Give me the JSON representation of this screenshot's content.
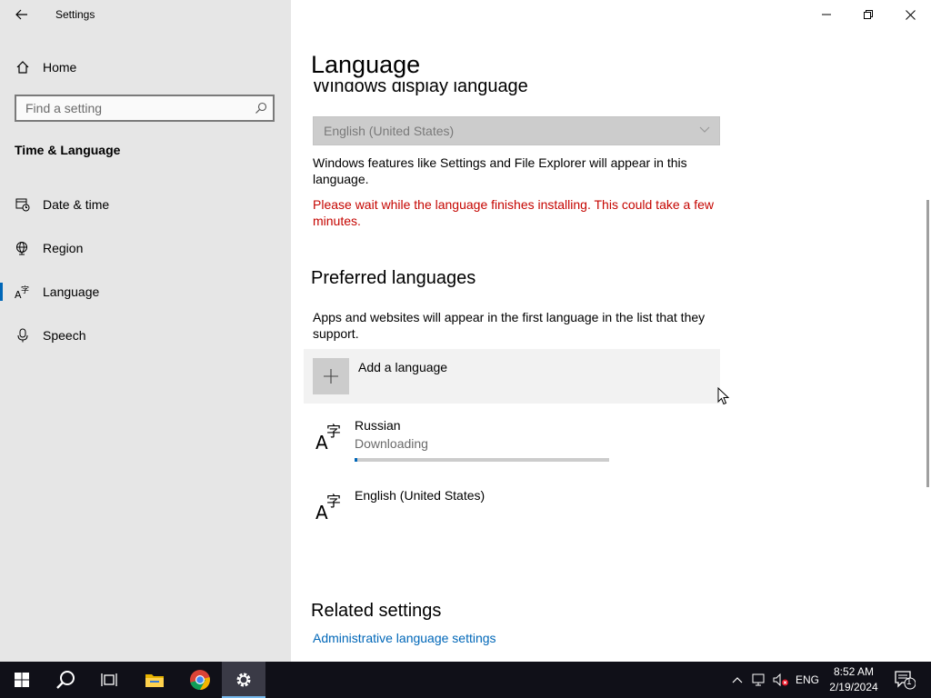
{
  "window": {
    "app_title": "Settings",
    "controls": [
      "minimize",
      "restore",
      "close"
    ]
  },
  "sidebar": {
    "home_label": "Home",
    "search_placeholder": "Find a setting",
    "section_heading": "Time & Language",
    "items": [
      {
        "label": "Date & time",
        "icon": "clock-calendar-icon",
        "selected": false
      },
      {
        "label": "Region",
        "icon": "globe-icon",
        "selected": false
      },
      {
        "label": "Language",
        "icon": "language-icon",
        "selected": true
      },
      {
        "label": "Speech",
        "icon": "microphone-icon",
        "selected": false
      }
    ]
  },
  "main": {
    "page_title": "Language",
    "display_language": {
      "heading": "Windows display language",
      "dropdown_value": "English (United States)",
      "description": "Windows features like Settings and File Explorer will appear in this language.",
      "warning": "Please wait while the language finishes installing. This could take a few minutes."
    },
    "preferred": {
      "heading": "Preferred languages",
      "description": "Apps and websites will appear in the first language in the list that they support.",
      "add_label": "Add a language",
      "languages": [
        {
          "name": "Russian",
          "status": "Downloading",
          "progress": 0.01
        },
        {
          "name": "English (United States)",
          "status": ""
        }
      ]
    },
    "related": {
      "heading": "Related settings",
      "link": "Administrative language settings"
    }
  },
  "taskbar": {
    "pinned": [
      "start-icon",
      "search-icon",
      "task-view-icon",
      "file-explorer-icon",
      "chrome-icon",
      "settings-icon"
    ],
    "active": "settings-icon",
    "language_indicator": "ENG",
    "time": "8:52 AM",
    "date": "2/19/2024",
    "notification_count": "1"
  },
  "colors": {
    "accent": "#0067b8",
    "warning": "#c50500",
    "sidebar_bg": "#e6e6e6",
    "taskbar_bg": "#101018"
  }
}
